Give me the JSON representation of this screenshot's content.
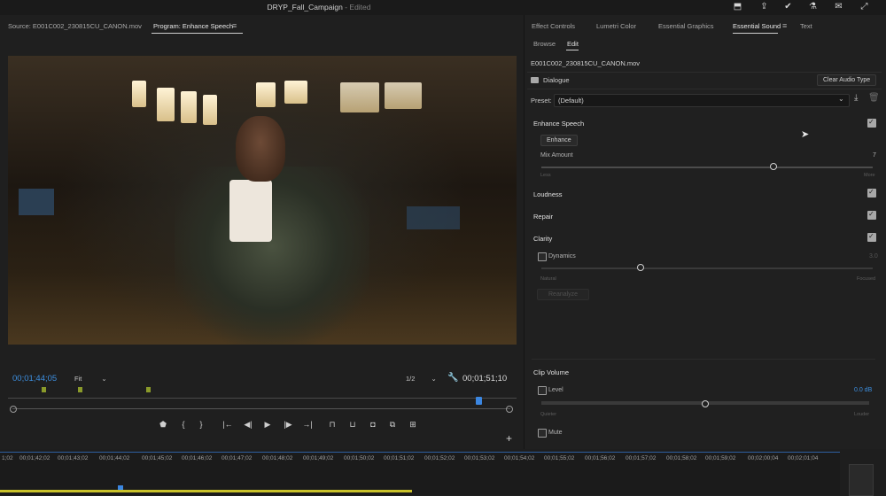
{
  "app": {
    "project_name": "DRYP_Fall_Campaign",
    "status": " - Edited",
    "top_icons": [
      "import-icon",
      "share-icon",
      "check-icon",
      "flask-icon",
      "chat-icon",
      "expand-icon"
    ]
  },
  "monitor": {
    "source_tab": "Source: E001C002_230815CU_CANON.mov",
    "program_tab": "Program: Enhance Speech",
    "menu_icon": "≡",
    "timecode_current": "00;01;44;05",
    "timecode_duration": "00;01;51;10",
    "zoom": "Fit",
    "resolution": "1/2",
    "wrench_icon": "wrench-icon",
    "transport": [
      {
        "name": "add-marker-button",
        "glyph": "⬟"
      },
      {
        "name": "mark-in-button",
        "glyph": "{"
      },
      {
        "name": "mark-out-button",
        "glyph": "}"
      },
      {
        "name": "go-to-in-button",
        "glyph": "|←"
      },
      {
        "name": "step-back-button",
        "glyph": "◀|"
      },
      {
        "name": "play-button",
        "glyph": "▶"
      },
      {
        "name": "step-forward-button",
        "glyph": "|▶"
      },
      {
        "name": "go-to-out-button",
        "glyph": "→|"
      },
      {
        "name": "lift-button",
        "glyph": "⊓"
      },
      {
        "name": "extract-button",
        "glyph": "⊔"
      },
      {
        "name": "export-frame-button",
        "glyph": "◘"
      },
      {
        "name": "compare-button",
        "glyph": "⧉"
      },
      {
        "name": "multicam-button",
        "glyph": "⊞"
      }
    ],
    "add_button": "+"
  },
  "timeline": {
    "ticks": [
      "1;02",
      "00;01;42;02",
      "00;01;43;02",
      "00;01;44;02",
      "00;01;45;02",
      "00;01;46;02",
      "00;01;47;02",
      "00;01;48;02",
      "00;01;49;02",
      "00;01;50;02",
      "00;01;51;02",
      "00;01;52;02",
      "00;01;53;02",
      "00;01;54;02",
      "00;01;55;02",
      "00;01;56;02",
      "00;01;57;02",
      "00;01;58;02",
      "00;01;59;02",
      "00;02;00;04",
      "00;02;01;04"
    ]
  },
  "essential_sound": {
    "panel_tabs": [
      "Effect Controls",
      "Lumetri Color",
      "Essential Graphics",
      "Essential Sound",
      "Text"
    ],
    "panel_menu_icon": "≡",
    "sub_tabs": [
      "Browse",
      "Edit"
    ],
    "clip_name": "E001C002_230815CU_CANON.mov",
    "type_label": "Dialogue",
    "clear_button": "Clear Audio Type",
    "preset_label": "Preset:",
    "preset_value": "(Default)",
    "enhance_speech": {
      "title": "Enhance Speech",
      "checked": true,
      "button": "Enhance",
      "mix_label": "Mix Amount",
      "mix_value": "7",
      "mix_fraction": 0.7,
      "min_label": "Less",
      "max_label": "More"
    },
    "loudness": {
      "title": "Loudness",
      "checked": true
    },
    "repair": {
      "title": "Repair",
      "checked": true
    },
    "clarity": {
      "title": "Clarity",
      "checked": true,
      "dynamics_label": "Dynamics",
      "dynamics_checked": false,
      "dynamics_value": "3.0",
      "dynamics_fraction": 0.3,
      "min_label": "Natural",
      "max_label": "Focused",
      "reanalyze": "Reanalyze"
    },
    "clip_volume": {
      "title": "Clip Volume",
      "level_label": "Level",
      "level_checked": false,
      "level_value": "0.0 dB",
      "level_fraction": 0.5,
      "min_label": "Quieter",
      "max_label": "Louder",
      "mute_label": "Mute",
      "mute_checked": false
    }
  }
}
